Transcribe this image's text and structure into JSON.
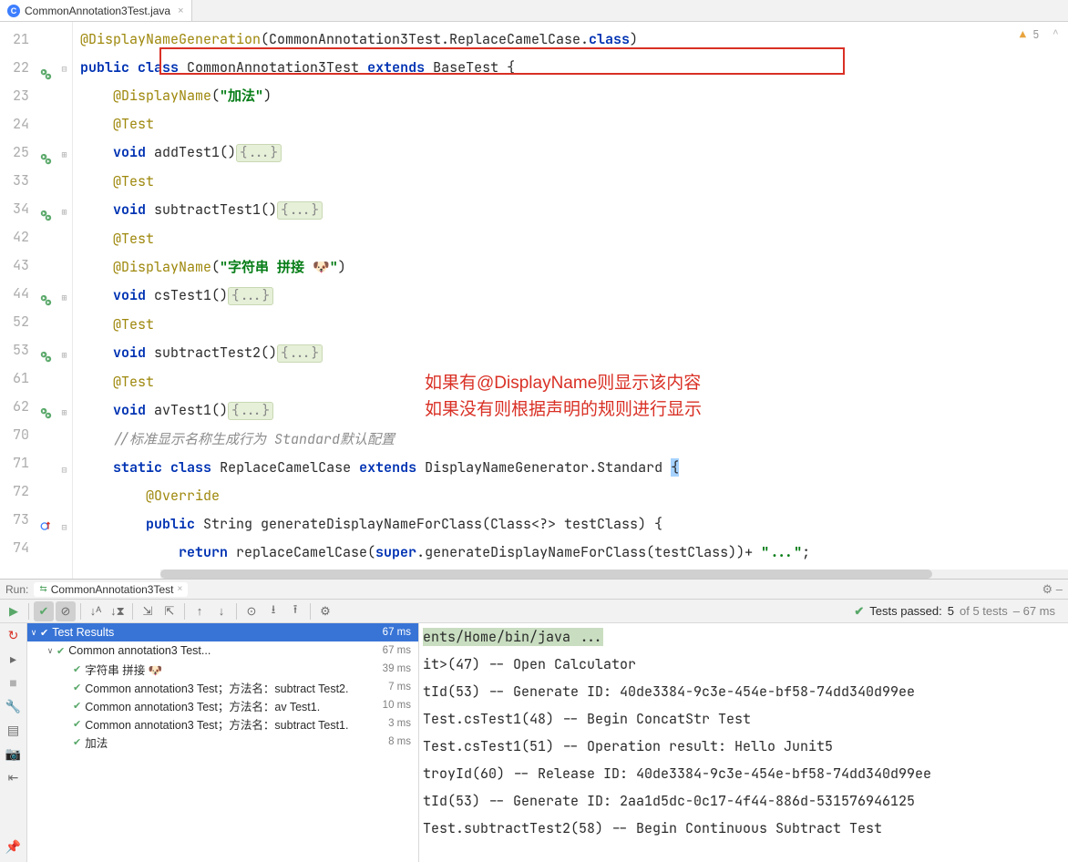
{
  "tab": {
    "filename": "CommonAnnotation3Test.java"
  },
  "warnings": {
    "count": "5"
  },
  "annotation_text": {
    "line1": "如果有@DisplayName则显示该内容",
    "line2": "如果没有则根据声明的规则进行显示"
  },
  "code_lines": [
    {
      "n": "21",
      "gut": "",
      "fold": "",
      "html": "<span class='ann'>@DisplayNameGeneration</span>(CommonAnnotation3Test.ReplaceCamelCase.<span class='k'>class</span>)"
    },
    {
      "n": "22",
      "gut": "run",
      "fold": "-",
      "html": "<span class='k'>public</span> <span class='k'>class</span> CommonAnnotation3Test <span class='k'>extends</span> BaseTest {"
    },
    {
      "n": "23",
      "gut": "",
      "fold": "",
      "html": "    <span class='ann'>@DisplayName</span>(<span class='str'>\"加法\"</span>)"
    },
    {
      "n": "24",
      "gut": "",
      "fold": "",
      "html": "    <span class='ann'>@Test</span>"
    },
    {
      "n": "25",
      "gut": "run",
      "fold": "+",
      "html": "    <span class='k'>void</span> addTest1()<span class='fold-span'>{...}</span>"
    },
    {
      "n": "33",
      "gut": "",
      "fold": "",
      "html": "    <span class='ann'>@Test</span>"
    },
    {
      "n": "34",
      "gut": "run",
      "fold": "+",
      "html": "    <span class='k'>void</span> subtractTest1()<span class='fold-span'>{...}</span>"
    },
    {
      "n": "42",
      "gut": "",
      "fold": "",
      "html": "    <span class='ann'>@Test</span>"
    },
    {
      "n": "43",
      "gut": "",
      "fold": "",
      "html": "    <span class='ann'>@DisplayName</span>(<span class='str'>\"字符串 拼接 🐶\"</span>)"
    },
    {
      "n": "44",
      "gut": "run",
      "fold": "+",
      "html": "    <span class='k'>void</span> csTest1()<span class='fold-span'>{...}</span>"
    },
    {
      "n": "52",
      "gut": "",
      "fold": "",
      "html": "    <span class='ann'>@Test</span>"
    },
    {
      "n": "53",
      "gut": "run",
      "fold": "+",
      "html": "    <span class='k'>void</span> subtractTest2()<span class='fold-span'>{...}</span>"
    },
    {
      "n": "61",
      "gut": "",
      "fold": "",
      "html": "    <span class='ann'>@Test</span>"
    },
    {
      "n": "62",
      "gut": "run",
      "fold": "+",
      "html": "    <span class='k'>void</span> avTest1()<span class='fold-span'>{...}</span>"
    },
    {
      "n": "70",
      "gut": "",
      "fold": "",
      "html": "    <span class='com'>//标准显示名称生成行为 Standard</span><span class='com'>默认配置</span>"
    },
    {
      "n": "71",
      "gut": "",
      "fold": "-",
      "html": "    <span class='k'>static</span> <span class='k'>class</span> ReplaceCamelCase <span class='k'>extends</span> DisplayNameGenerator.Standard <span class='sel'>{</span>"
    },
    {
      "n": "72",
      "gut": "",
      "fold": "",
      "html": "        <span class='ann'>@Override</span>"
    },
    {
      "n": "73",
      "gut": "ov",
      "fold": "-",
      "html": "        <span class='k'>public</span> String generateDisplayNameForClass(Class&lt;?&gt; testClass) {"
    },
    {
      "n": "74",
      "gut": "",
      "fold": "",
      "html": "            <span class='k'>return</span> replaceCamelCase(<span class='k'>super</span>.generateDisplayNameForClass(testClass))+ <span class='str'>\"...\"</span>;"
    }
  ],
  "run": {
    "label": "Run:",
    "config": "CommonAnnotation3Test",
    "status_passed": "Tests passed:",
    "status_count": "5",
    "status_of": "of 5 tests",
    "status_time": "– 67 ms"
  },
  "tree": [
    {
      "indent": 0,
      "arrow": "∨",
      "sel": true,
      "label": "Test Results",
      "time": "67 ms"
    },
    {
      "indent": 1,
      "arrow": "∨",
      "label": "Common annotation3 Test...",
      "time": "67 ms"
    },
    {
      "indent": 2,
      "arrow": "",
      "label": "字符串 拼接 🐶",
      "time": "39 ms"
    },
    {
      "indent": 2,
      "arrow": "",
      "label": "Common annotation3 Test；方法名：subtract Test2.",
      "time": "7 ms"
    },
    {
      "indent": 2,
      "arrow": "",
      "label": "Common annotation3 Test；方法名：av Test1.",
      "time": "10 ms"
    },
    {
      "indent": 2,
      "arrow": "",
      "label": "Common annotation3 Test；方法名：subtract Test1.",
      "time": "3 ms"
    },
    {
      "indent": 2,
      "arrow": "",
      "label": "加法",
      "time": "8 ms"
    }
  ],
  "console": [
    {
      "hl": true,
      "text": "ents/Home/bin/java ..."
    },
    {
      "hl": false,
      "text": "it>(47) -- Open Calculator"
    },
    {
      "hl": false,
      "text": "tId(53) -- Generate ID: 40de3384-9c3e-454e-bf58-74dd340d99ee"
    },
    {
      "hl": false,
      "text": "Test.csTest1(48) -- Begin ConcatStr Test"
    },
    {
      "hl": false,
      "text": "Test.csTest1(51) -- Operation result: Hello Junit5"
    },
    {
      "hl": false,
      "text": "troyId(60) -- Release ID: 40de3384-9c3e-454e-bf58-74dd340d99ee"
    },
    {
      "hl": false,
      "text": "tId(53) -- Generate ID: 2aa1d5dc-0c17-4f44-886d-531576946125"
    },
    {
      "hl": false,
      "text": "Test.subtractTest2(58) -- Begin Continuous Subtract Test"
    }
  ]
}
